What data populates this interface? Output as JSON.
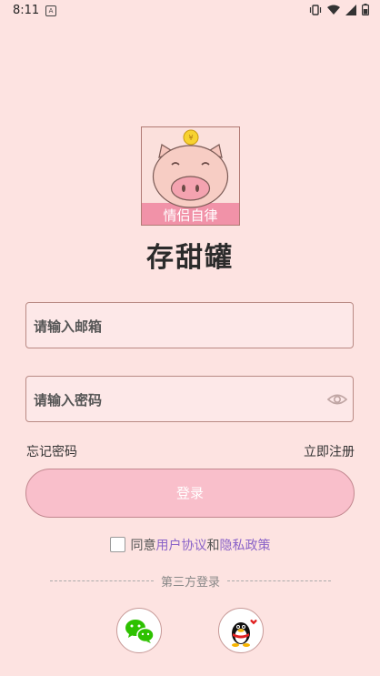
{
  "status_bar": {
    "time": "8:11"
  },
  "app": {
    "logo_caption": "情侣自律",
    "title": "存甜罐"
  },
  "login": {
    "email_placeholder": "请输入邮箱",
    "password_placeholder": "请输入密码",
    "forgot_password": "忘记密码",
    "register": "立即注册",
    "submit": "登录"
  },
  "agreement": {
    "prefix": "同意",
    "user_agreement": "用户协议",
    "and": "和",
    "privacy_policy": "隐私政策"
  },
  "third_party": {
    "label": "第三方登录"
  },
  "icons": [
    "wechat-icon",
    "qq-icon",
    "eye-icon"
  ],
  "colors": {
    "background": "#fde3e1",
    "accent": "#8a63c8",
    "button": "#f9bfcb"
  }
}
